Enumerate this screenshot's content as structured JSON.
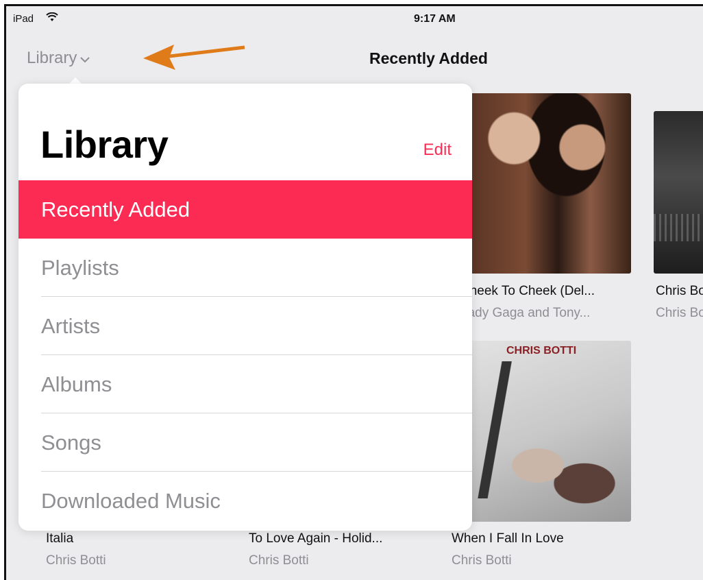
{
  "status_bar": {
    "device": "iPad",
    "time": "9:17 AM"
  },
  "nav": {
    "library_button": "Library",
    "title": "Recently Added"
  },
  "popover": {
    "title": "Library",
    "edit": "Edit",
    "items": [
      {
        "label": "Recently Added",
        "selected": true
      },
      {
        "label": "Playlists"
      },
      {
        "label": "Artists"
      },
      {
        "label": "Albums"
      },
      {
        "label": "Songs"
      },
      {
        "label": "Downloaded Music"
      }
    ]
  },
  "albums": [
    {
      "title": "Cheek To Cheek (Del...",
      "artist": "Lady Gaga and Tony..."
    },
    {
      "title": "Chris Botti",
      "artist": "Chris Botti"
    },
    {
      "title": "When I Fall In Love",
      "artist": "Chris Botti",
      "art_text": "CHRIS BOTTI"
    },
    {
      "title": "Italia",
      "artist": "Chris Botti"
    },
    {
      "title": "To Love Again - Holid...",
      "artist": "Chris Botti"
    }
  ],
  "colors": {
    "accent": "#fb2b54",
    "edit": "#fa2d55",
    "secondary_text": "#8e8e93",
    "annotation_arrow": "#e07b1a"
  }
}
